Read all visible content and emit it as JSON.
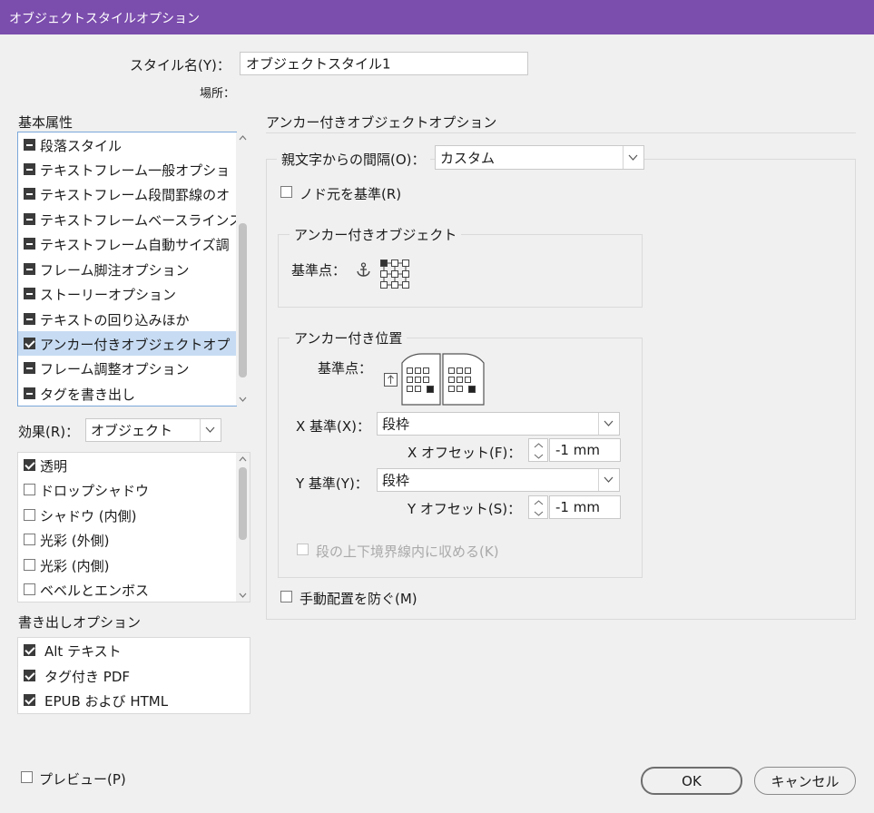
{
  "window": {
    "title": "オブジェクトスタイルオプション"
  },
  "style_name": {
    "label": "スタイル名(Y)：",
    "value": "オブジェクトスタイル1",
    "location_label": "場所："
  },
  "basic_attributes": {
    "heading": "基本属性",
    "items": [
      {
        "label": "段落スタイル",
        "state": "mixed"
      },
      {
        "label": "テキストフレーム一般オプショ",
        "state": "mixed"
      },
      {
        "label": "テキストフレーム段間罫線のオ",
        "state": "mixed"
      },
      {
        "label": "テキストフレームベースラインス",
        "state": "mixed"
      },
      {
        "label": "テキストフレーム自動サイズ調",
        "state": "mixed"
      },
      {
        "label": "フレーム脚注オプション",
        "state": "mixed"
      },
      {
        "label": "ストーリーオプション",
        "state": "mixed"
      },
      {
        "label": "テキストの回り込みほか",
        "state": "mixed"
      },
      {
        "label": "アンカー付きオブジェクトオプ",
        "state": "checked",
        "selected": true
      },
      {
        "label": "フレーム調整オプション",
        "state": "mixed"
      },
      {
        "label": "タグを書き出し",
        "state": "mixed"
      }
    ]
  },
  "effects": {
    "label": "効果(R)：",
    "target": "オブジェクト",
    "items": [
      {
        "label": "透明",
        "checked": true
      },
      {
        "label": "ドロップシャドウ",
        "checked": false
      },
      {
        "label": "シャドウ (内側)",
        "checked": false
      },
      {
        "label": "光彩 (外側)",
        "checked": false
      },
      {
        "label": "光彩 (内側)",
        "checked": false
      },
      {
        "label": "ベベルとエンボス",
        "checked": false
      }
    ]
  },
  "export_options": {
    "heading": "書き出しオプション",
    "items": [
      {
        "label": "Alt テキスト",
        "checked": true
      },
      {
        "label": "タグ付き PDF",
        "checked": true
      },
      {
        "label": "EPUB および HTML",
        "checked": true
      }
    ]
  },
  "anchored": {
    "heading": "アンカー付きオブジェクトオプション",
    "spacing_label": "親文字からの間隔(O)：",
    "spacing_value": "カスタム",
    "relative_to_spine_label": "ノド元を基準(R)",
    "object_group": {
      "title": "アンカー付きオブジェクト",
      "ref_label": "基準点："
    },
    "position_group": {
      "title": "アンカー付き位置",
      "ref_label": "基準点：",
      "x_ref_label": "X 基準(X)：",
      "x_ref_value": "段枠",
      "x_offset_label": "X オフセット(F)：",
      "x_offset_value": "-1 mm",
      "y_ref_label": "Y 基準(Y)：",
      "y_ref_value": "段枠",
      "y_offset_label": "Y オフセット(S)：",
      "y_offset_value": "-1 mm",
      "keep_within_label": "段の上下境界線内に収める(K)"
    },
    "prevent_manual_label": "手動配置を防ぐ(M)"
  },
  "footer": {
    "preview_label": "プレビュー(P)",
    "ok_label": "OK",
    "cancel_label": "キャンセル"
  },
  "colors": {
    "titlebar": "#7b4dad",
    "selection": "#c7dcf3",
    "focus_border": "#7aa7d9"
  },
  "icons": [
    "anchor-icon",
    "reference-point-grid-icon",
    "page-spread-icon",
    "chevron-down-icon",
    "spinner-icon"
  ]
}
